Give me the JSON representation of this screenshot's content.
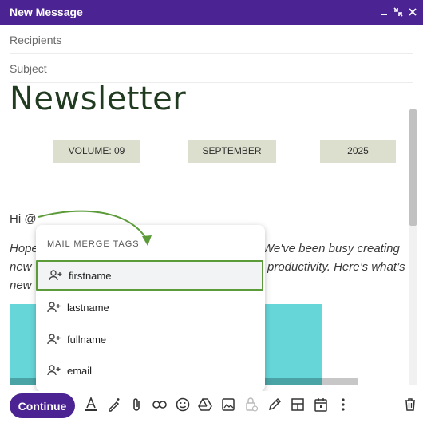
{
  "window": {
    "title": "New Message"
  },
  "fields": {
    "recipients": "Recipients",
    "subject": "Subject"
  },
  "newsletter": {
    "heading": "Newsletter",
    "volume": "VOLUME: 09",
    "month": "SEPTEMBER",
    "year": "2025"
  },
  "body": {
    "greeting": "Hi @",
    "line1_left": "Hope",
    "line1_right": "We've been busy creating",
    "line2_left": "new",
    "line2_right": "productivity. Here’s what’s",
    "line3_left": "new"
  },
  "merge_popup": {
    "header": "MAIL MERGE TAGS",
    "items": [
      {
        "label": "firstname",
        "selected": true
      },
      {
        "label": "lastname"
      },
      {
        "label": "fullname"
      },
      {
        "label": "email"
      }
    ]
  },
  "toolbar": {
    "continue_label": "Continue",
    "icons": [
      "text-format-icon",
      "magic-pen-icon",
      "attachment-icon",
      "link-icon",
      "emoji-icon",
      "drive-icon",
      "image-icon",
      "lock-clock-icon",
      "pen-icon",
      "layout-icon",
      "schedule-icon",
      "more-icon",
      "trash-icon"
    ]
  },
  "colors": {
    "brand": "#4c2392",
    "pill": "#dcdfce",
    "highlight": "#5c9b3a",
    "banner": "#66d6d8"
  }
}
